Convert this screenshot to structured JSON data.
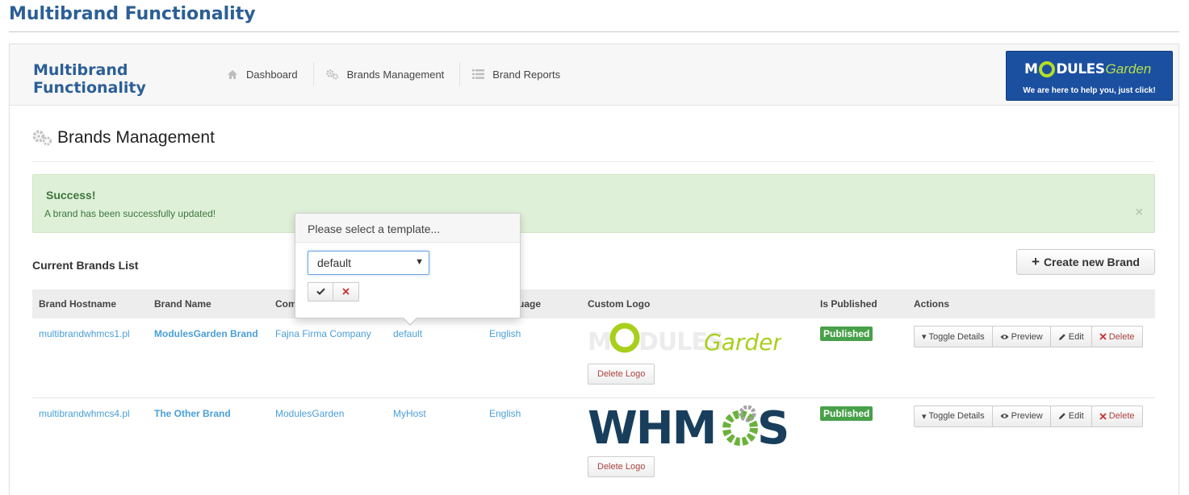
{
  "page_title": "Multibrand Functionality",
  "topbar": {
    "module_name": "Multibrand Functionality",
    "nav": [
      {
        "label": "Dashboard",
        "icon": "home-icon"
      },
      {
        "label": "Brands Management",
        "icon": "gears-icon"
      },
      {
        "label": "Brand Reports",
        "icon": "list-icon"
      }
    ],
    "banner": {
      "brand_a": "M",
      "brand_b": "DULES",
      "brand_c": "Garden",
      "tagline": "We are here to help you, just click!"
    }
  },
  "section": {
    "title": "Brands Management",
    "icon": "gears-icon"
  },
  "alert": {
    "title": "Success!",
    "message": "A brand has been successfully updated!",
    "close": "×"
  },
  "list": {
    "title": "Current Brands List",
    "create_label": "Create new Brand"
  },
  "table": {
    "headers": {
      "hostname": "Brand Hostname",
      "name": "Brand Name",
      "company": "Com",
      "template": "",
      "language": "t Language",
      "logo": "Custom Logo",
      "published": "Is Published",
      "actions": "Actions"
    },
    "rows": [
      {
        "hostname": "multibrandwhmcs1.pl",
        "name": "ModulesGarden Brand",
        "company": "Fajna Firma Company",
        "template": "default",
        "language": "English",
        "logo": {
          "a": "M",
          "b": "DULES",
          "c": "Garden"
        },
        "delete_logo": "Delete Logo",
        "published": "Published"
      },
      {
        "hostname": "multibrandwhmcs4.pl",
        "name": "The Other Brand",
        "company": "ModulesGarden",
        "template": "MyHost",
        "language": "English",
        "logo": {
          "a": "WHM",
          "b": "S"
        },
        "delete_logo": "Delete Logo",
        "published": "Published"
      }
    ],
    "actions": {
      "toggle": "Toggle Details",
      "preview": "Preview",
      "edit": "Edit",
      "delete": "Delete"
    }
  },
  "popover": {
    "title": "Please select a template...",
    "selected": "default"
  },
  "colors": {
    "title_blue": "#2c5f96",
    "link": "#4a9fd8",
    "success_bg": "#dff0d8",
    "published": "#48a04a",
    "danger": "#a94442",
    "banner": "#1b4fa0"
  }
}
